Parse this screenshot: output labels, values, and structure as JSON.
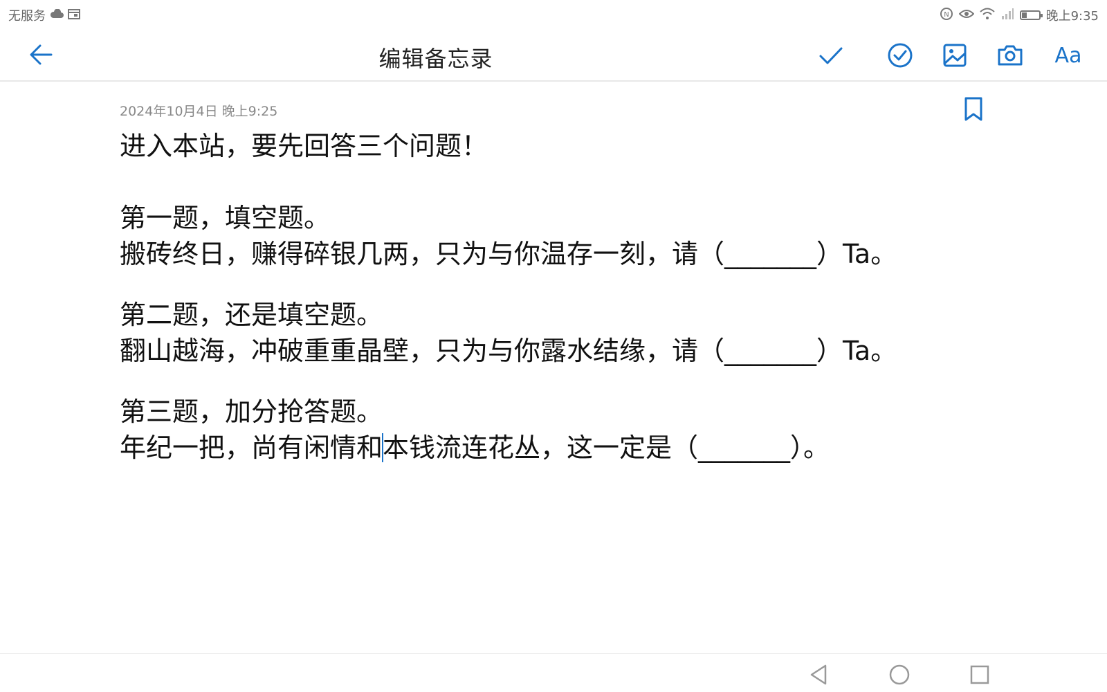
{
  "status_bar": {
    "carrier": "无服务",
    "time": "晚上9:35",
    "icons": [
      "cloud-icon",
      "calendar-icon",
      "nfc-icon",
      "eye-icon",
      "wifi-icon",
      "signal-icon",
      "battery-icon"
    ],
    "battery_level": 0.3
  },
  "header": {
    "title": "编辑备忘录",
    "font_button_label": "Aa",
    "accent_color": "#1a73c9"
  },
  "note": {
    "date": "2024年10月4日 晚上9:25",
    "line1": "进入本站，要先回答三个问题！",
    "q1_title": "第一题，填空题。",
    "q1_text": "搬砖终日，赚得碎银几两，只为与你温存一刻，请（_______）Ta。",
    "q2_title": "第二题，还是填空题。",
    "q2_text": "翻山越海，冲破重重晶壁，只为与你露水结缘，请（_______）Ta。",
    "q3_title": "第三题，加分抢答题。",
    "q3_text_before_cursor": "年纪一把，尚有闲情和",
    "q3_text_after_cursor": "本钱流连花丛，这一定是（_______）。"
  }
}
